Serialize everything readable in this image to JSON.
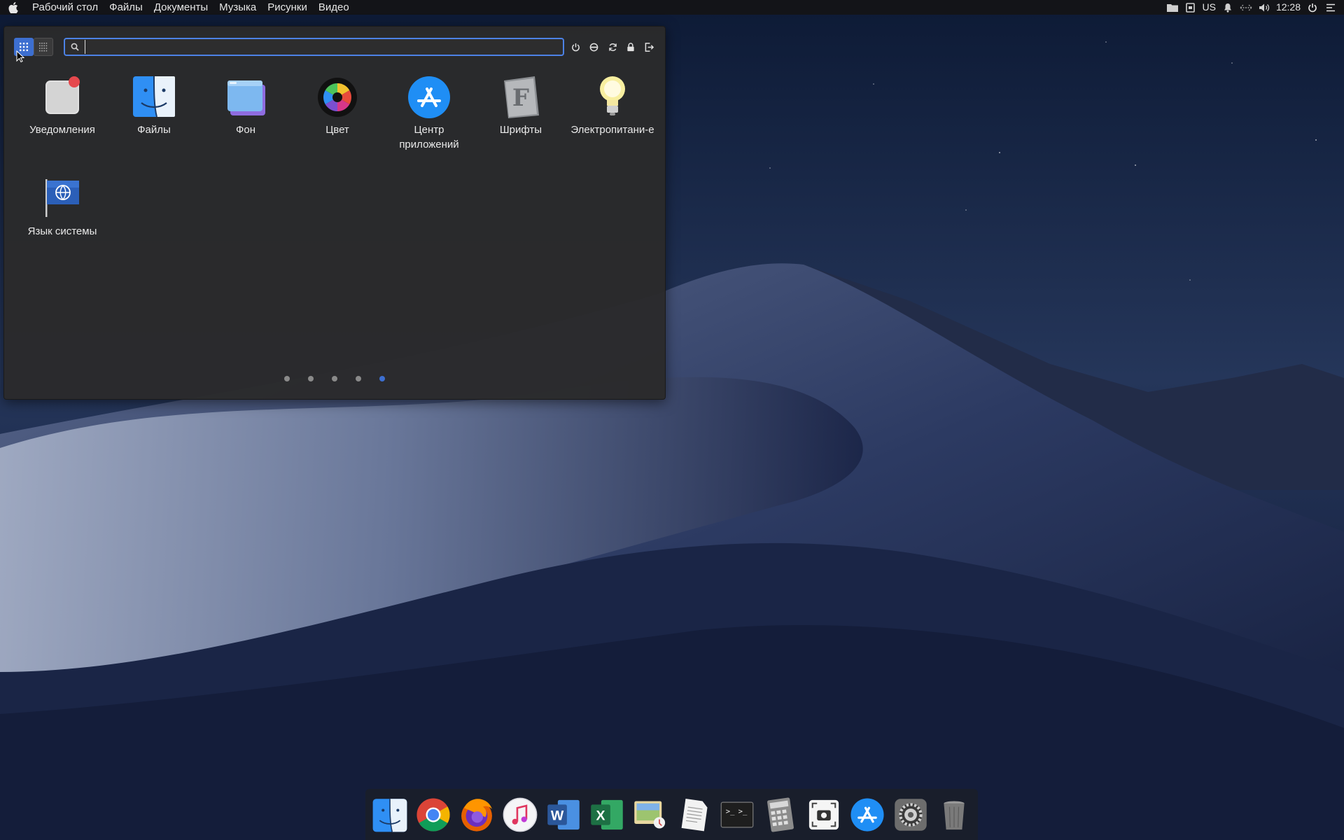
{
  "topbar": {
    "menus": [
      "Рабочий стол",
      "Файлы",
      "Документы",
      "Музыка",
      "Рисунки",
      "Видео"
    ],
    "status": {
      "keyboard_layout": "US",
      "clock": "12:28"
    },
    "status_icons": [
      "folder-icon",
      "keyboard-icon",
      "bell-icon",
      "network-icon",
      "volume-icon",
      "power-icon",
      "menu-lines-icon"
    ]
  },
  "launcher": {
    "search": {
      "value": "",
      "placeholder": ""
    },
    "actions": [
      "power-icon",
      "suspend-icon",
      "restart-icon",
      "lock-icon",
      "logout-icon"
    ],
    "apps": [
      {
        "label": "Уведомления",
        "icon": "notifications-icon"
      },
      {
        "label": "Файлы",
        "icon": "finder-icon"
      },
      {
        "label": "Фон",
        "icon": "wallpaper-icon"
      },
      {
        "label": "Цвет",
        "icon": "color-wheel-icon"
      },
      {
        "label": "Центр приложений",
        "icon": "app-store-icon"
      },
      {
        "label": "Шрифты",
        "icon": "fonts-icon"
      },
      {
        "label": "Электропитани-е",
        "icon": "lightbulb-icon"
      },
      {
        "label": "Язык системы",
        "icon": "globe-flag-icon"
      }
    ],
    "pages": {
      "count": 5,
      "current": 5
    }
  },
  "dock": {
    "items": [
      "finder-icon",
      "chrome-icon",
      "firefox-icon",
      "music-icon",
      "word-icon",
      "excel-icon",
      "photo-viewer-icon",
      "text-editor-icon",
      "terminal-icon",
      "calculator-icon",
      "screenshot-icon",
      "app-store-icon",
      "settings-gear-icon",
      "trash-icon"
    ]
  },
  "colors": {
    "accent": "#3d6fd0",
    "panel": "#2a2a2b",
    "topbar": "#141416"
  }
}
